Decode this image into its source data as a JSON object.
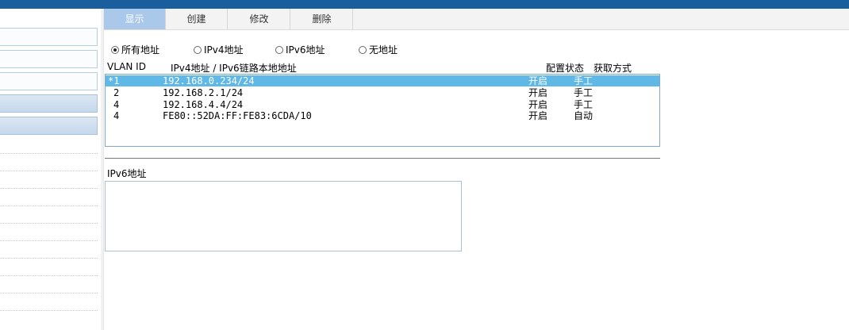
{
  "tabs": [
    {
      "label": "显示",
      "active": true
    },
    {
      "label": "创建",
      "active": false
    },
    {
      "label": "修改",
      "active": false
    },
    {
      "label": "删除",
      "active": false
    }
  ],
  "filter": {
    "options": [
      {
        "label": "所有地址",
        "checked": true
      },
      {
        "label": "IPv4地址",
        "checked": false
      },
      {
        "label": "IPv6地址",
        "checked": false
      },
      {
        "label": "无地址",
        "checked": false
      }
    ]
  },
  "table": {
    "headers": {
      "vlan_id": "VLAN ID",
      "address": "IPv4地址 / IPv6链路本地地址",
      "config_state": "配置状态",
      "acquire_method": "获取方式"
    },
    "rows": [
      {
        "vlan": "*1",
        "address": "192.168.0.234/24",
        "state": "开启",
        "method": "手工",
        "selected": true
      },
      {
        "vlan": "2",
        "address": "192.168.2.1/24",
        "state": "开启",
        "method": "手工",
        "selected": false
      },
      {
        "vlan": "4",
        "address": "192.168.4.4/24",
        "state": "开启",
        "method": "手工",
        "selected": false
      },
      {
        "vlan": "4",
        "address": "FE80::52DA:FF:FE83:6CDA/10",
        "state": "开启",
        "method": "自动",
        "selected": false
      }
    ]
  },
  "ipv6_section": {
    "label": "IPv6地址"
  },
  "colors": {
    "topbar": "#1b5e9e",
    "tab_active": "#a9c8ea",
    "row_selected": "#5fb8e6",
    "listbox_border": "#7fa7c9"
  }
}
